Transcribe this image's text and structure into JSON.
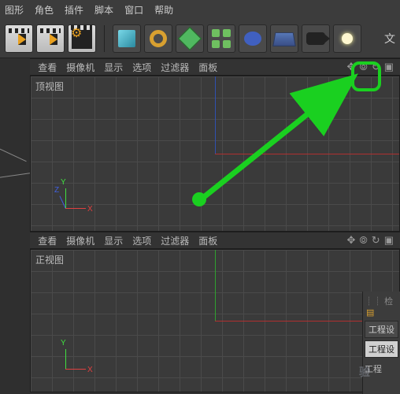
{
  "menu": {
    "items": [
      "图形",
      "角色",
      "插件",
      "脚本",
      "窗口",
      "帮助"
    ]
  },
  "toolbar": {
    "doc_label": "文"
  },
  "view_common": {
    "menus": [
      "查看",
      "摄像机",
      "显示",
      "选项",
      "过滤器",
      "面板"
    ]
  },
  "viewports": {
    "top": {
      "title": "顶视图"
    },
    "front": {
      "title": "正视图"
    }
  },
  "axis_labels": {
    "x": "X",
    "y": "Y",
    "z": "Z"
  },
  "right_panel": {
    "sec1": "检",
    "items": [
      "工程设",
      "工程设"
    ],
    "active_index": 1,
    "footer": "工程"
  },
  "watermark": "验"
}
